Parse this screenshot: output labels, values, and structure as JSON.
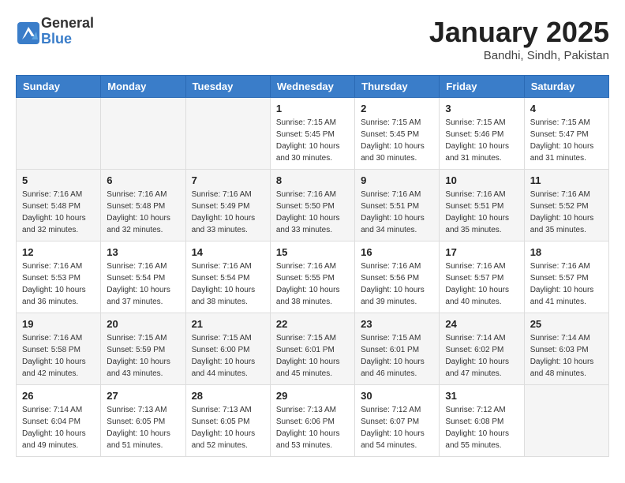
{
  "header": {
    "logo": {
      "general": "General",
      "blue": "Blue"
    },
    "title": "January 2025",
    "location": "Bandhi, Sindh, Pakistan"
  },
  "days_of_week": [
    "Sunday",
    "Monday",
    "Tuesday",
    "Wednesday",
    "Thursday",
    "Friday",
    "Saturday"
  ],
  "weeks": [
    {
      "days": [
        {
          "number": "",
          "info": ""
        },
        {
          "number": "",
          "info": ""
        },
        {
          "number": "",
          "info": ""
        },
        {
          "number": "1",
          "info": "Sunrise: 7:15 AM\nSunset: 5:45 PM\nDaylight: 10 hours\nand 30 minutes."
        },
        {
          "number": "2",
          "info": "Sunrise: 7:15 AM\nSunset: 5:45 PM\nDaylight: 10 hours\nand 30 minutes."
        },
        {
          "number": "3",
          "info": "Sunrise: 7:15 AM\nSunset: 5:46 PM\nDaylight: 10 hours\nand 31 minutes."
        },
        {
          "number": "4",
          "info": "Sunrise: 7:15 AM\nSunset: 5:47 PM\nDaylight: 10 hours\nand 31 minutes."
        }
      ]
    },
    {
      "days": [
        {
          "number": "5",
          "info": "Sunrise: 7:16 AM\nSunset: 5:48 PM\nDaylight: 10 hours\nand 32 minutes."
        },
        {
          "number": "6",
          "info": "Sunrise: 7:16 AM\nSunset: 5:48 PM\nDaylight: 10 hours\nand 32 minutes."
        },
        {
          "number": "7",
          "info": "Sunrise: 7:16 AM\nSunset: 5:49 PM\nDaylight: 10 hours\nand 33 minutes."
        },
        {
          "number": "8",
          "info": "Sunrise: 7:16 AM\nSunset: 5:50 PM\nDaylight: 10 hours\nand 33 minutes."
        },
        {
          "number": "9",
          "info": "Sunrise: 7:16 AM\nSunset: 5:51 PM\nDaylight: 10 hours\nand 34 minutes."
        },
        {
          "number": "10",
          "info": "Sunrise: 7:16 AM\nSunset: 5:51 PM\nDaylight: 10 hours\nand 35 minutes."
        },
        {
          "number": "11",
          "info": "Sunrise: 7:16 AM\nSunset: 5:52 PM\nDaylight: 10 hours\nand 35 minutes."
        }
      ]
    },
    {
      "days": [
        {
          "number": "12",
          "info": "Sunrise: 7:16 AM\nSunset: 5:53 PM\nDaylight: 10 hours\nand 36 minutes."
        },
        {
          "number": "13",
          "info": "Sunrise: 7:16 AM\nSunset: 5:54 PM\nDaylight: 10 hours\nand 37 minutes."
        },
        {
          "number": "14",
          "info": "Sunrise: 7:16 AM\nSunset: 5:54 PM\nDaylight: 10 hours\nand 38 minutes."
        },
        {
          "number": "15",
          "info": "Sunrise: 7:16 AM\nSunset: 5:55 PM\nDaylight: 10 hours\nand 38 minutes."
        },
        {
          "number": "16",
          "info": "Sunrise: 7:16 AM\nSunset: 5:56 PM\nDaylight: 10 hours\nand 39 minutes."
        },
        {
          "number": "17",
          "info": "Sunrise: 7:16 AM\nSunset: 5:57 PM\nDaylight: 10 hours\nand 40 minutes."
        },
        {
          "number": "18",
          "info": "Sunrise: 7:16 AM\nSunset: 5:57 PM\nDaylight: 10 hours\nand 41 minutes."
        }
      ]
    },
    {
      "days": [
        {
          "number": "19",
          "info": "Sunrise: 7:16 AM\nSunset: 5:58 PM\nDaylight: 10 hours\nand 42 minutes."
        },
        {
          "number": "20",
          "info": "Sunrise: 7:15 AM\nSunset: 5:59 PM\nDaylight: 10 hours\nand 43 minutes."
        },
        {
          "number": "21",
          "info": "Sunrise: 7:15 AM\nSunset: 6:00 PM\nDaylight: 10 hours\nand 44 minutes."
        },
        {
          "number": "22",
          "info": "Sunrise: 7:15 AM\nSunset: 6:01 PM\nDaylight: 10 hours\nand 45 minutes."
        },
        {
          "number": "23",
          "info": "Sunrise: 7:15 AM\nSunset: 6:01 PM\nDaylight: 10 hours\nand 46 minutes."
        },
        {
          "number": "24",
          "info": "Sunrise: 7:14 AM\nSunset: 6:02 PM\nDaylight: 10 hours\nand 47 minutes."
        },
        {
          "number": "25",
          "info": "Sunrise: 7:14 AM\nSunset: 6:03 PM\nDaylight: 10 hours\nand 48 minutes."
        }
      ]
    },
    {
      "days": [
        {
          "number": "26",
          "info": "Sunrise: 7:14 AM\nSunset: 6:04 PM\nDaylight: 10 hours\nand 49 minutes."
        },
        {
          "number": "27",
          "info": "Sunrise: 7:13 AM\nSunset: 6:05 PM\nDaylight: 10 hours\nand 51 minutes."
        },
        {
          "number": "28",
          "info": "Sunrise: 7:13 AM\nSunset: 6:05 PM\nDaylight: 10 hours\nand 52 minutes."
        },
        {
          "number": "29",
          "info": "Sunrise: 7:13 AM\nSunset: 6:06 PM\nDaylight: 10 hours\nand 53 minutes."
        },
        {
          "number": "30",
          "info": "Sunrise: 7:12 AM\nSunset: 6:07 PM\nDaylight: 10 hours\nand 54 minutes."
        },
        {
          "number": "31",
          "info": "Sunrise: 7:12 AM\nSunset: 6:08 PM\nDaylight: 10 hours\nand 55 minutes."
        },
        {
          "number": "",
          "info": ""
        }
      ]
    }
  ]
}
